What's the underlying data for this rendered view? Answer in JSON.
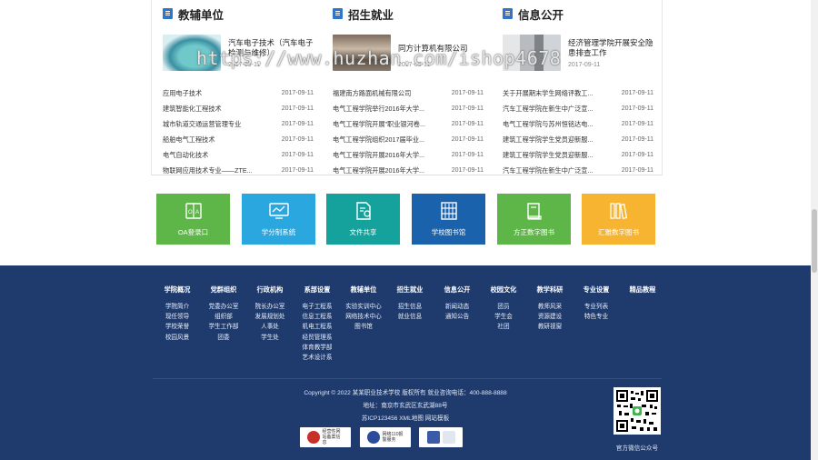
{
  "columns": [
    {
      "title": "教辅单位",
      "feature": {
        "title": "汽车电子技术（汽车电子检测与维修）",
        "date": "2017-09-11"
      },
      "items": [
        {
          "text": "应用电子技术",
          "date": "2017-09-11"
        },
        {
          "text": "建筑智能化工程技术",
          "date": "2017-09-11"
        },
        {
          "text": "城市轨道交通运营管理专业",
          "date": "2017-09-11"
        },
        {
          "text": "船舶电气工程技术",
          "date": "2017-09-11"
        },
        {
          "text": "电气自动化技术",
          "date": "2017-09-11"
        },
        {
          "text": "物联网应用技术专业——ZTE...",
          "date": "2017-09-11"
        }
      ]
    },
    {
      "title": "招生就业",
      "feature": {
        "title": "同方计算机有限公司",
        "date": "2017-09-11"
      },
      "items": [
        {
          "text": "福建南方路面机械有限公司",
          "date": "2017-09-11"
        },
        {
          "text": "电气工程学院举行2016年大学...",
          "date": "2017-09-11"
        },
        {
          "text": "电气工程学院开展\"职业银河卷...",
          "date": "2017-09-11"
        },
        {
          "text": "电气工程学院组织2017届毕业...",
          "date": "2017-09-11"
        },
        {
          "text": "电气工程学院开展2016年大学...",
          "date": "2017-09-11"
        },
        {
          "text": "电气工程学院开展2016年大学...",
          "date": "2017-09-11"
        }
      ]
    },
    {
      "title": "信息公开",
      "feature": {
        "title": "经济管理学院开展安全隐患排查工作",
        "date": "2017-09-11"
      },
      "items": [
        {
          "text": "关于开展期末学生网络评教工...",
          "date": "2017-09-11"
        },
        {
          "text": "汽车工程学院在新生中广泛宣...",
          "date": "2017-09-11"
        },
        {
          "text": "电气工程学院与苏州恒铭达电...",
          "date": "2017-09-11"
        },
        {
          "text": "建筑工程学院学生党员迎新服...",
          "date": "2017-09-11"
        },
        {
          "text": "建筑工程学院学生党员迎新服...",
          "date": "2017-09-11"
        },
        {
          "text": "汽车工程学院在新生中广泛宣...",
          "date": "2017-09-11"
        }
      ]
    }
  ],
  "watermark": "https://www.huzhan.com/ishop4678",
  "tiles": [
    {
      "label": "OA登录口",
      "color": "#5fb648",
      "icon": "oa-icon"
    },
    {
      "label": "学分制系统",
      "color": "#2aa7df",
      "icon": "monitor-chart-icon"
    },
    {
      "label": "文件共享",
      "color": "#15a29d",
      "icon": "file-share-icon"
    },
    {
      "label": "学校图书馆",
      "color": "#1b62ad",
      "icon": "library-icon"
    },
    {
      "label": "方正数字图书",
      "color": "#5fb648",
      "icon": "book-icon"
    },
    {
      "label": "汇雅数字图书",
      "color": "#f6b431",
      "icon": "bookshelf-icon"
    }
  ],
  "footer": {
    "columns": [
      {
        "heading": "学院概况",
        "items": [
          "学院简介",
          "现任领导",
          "学校荣誉",
          "校园风景"
        ]
      },
      {
        "heading": "党群组织",
        "items": [
          "党委办公室",
          "组织部",
          "学生工作部",
          "团委"
        ]
      },
      {
        "heading": "行政机构",
        "items": [
          "院长办公室",
          "发展规划处",
          "人事处",
          "学生处"
        ]
      },
      {
        "heading": "系部设置",
        "items": [
          "电子工程系",
          "信息工程系",
          "机电工程系",
          "经贸管理系",
          "体育教学部",
          "艺术设计系"
        ]
      },
      {
        "heading": "教辅单位",
        "items": [
          "实验实训中心",
          "网络技术中心",
          "图书馆"
        ]
      },
      {
        "heading": "招生就业",
        "items": [
          "招生信息",
          "就业信息"
        ]
      },
      {
        "heading": "信息公开",
        "items": [
          "新闻动态",
          "通知公告"
        ]
      },
      {
        "heading": "校园文化",
        "items": [
          "团员",
          "学生会",
          "社团"
        ]
      },
      {
        "heading": "教学科研",
        "items": [
          "教师风采",
          "资源建设",
          "教研视窗"
        ]
      },
      {
        "heading": "专业设置",
        "items": [
          "专业列表",
          "特色专业"
        ]
      },
      {
        "heading": "精品教程",
        "items": []
      }
    ],
    "copyright": "Copyright © 2022 某某职业技术学校 版权所有 就业咨询电话：400-888-8888",
    "address": "地址：南京市玄武区玄武湖88号",
    "icp": "苏ICP123456 XML地图 网站模板",
    "badges": [
      {
        "text": "经营性网站备案信息",
        "icon": "police-badge-icon",
        "color": "#c8302a"
      },
      {
        "text": "网络110报警服务",
        "icon": "police-shield-icon",
        "color": "#2c4b9c"
      },
      {
        "text": "",
        "icon": "credit-seal-icon",
        "color": "#3b5aa8"
      }
    ],
    "qr_caption": "官方微信公众号"
  }
}
